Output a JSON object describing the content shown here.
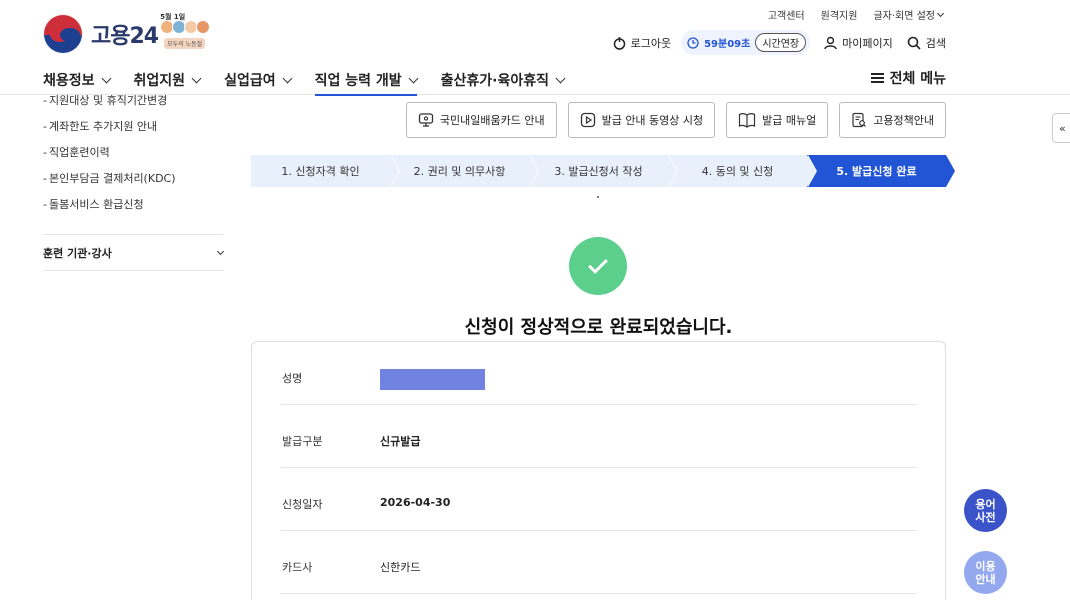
{
  "header": {
    "logo_text": "고용24",
    "logo_badge_date": "5월 1일",
    "logo_badge_ribbon": "모두의 노동절",
    "util_links": [
      "고객센터",
      "원격지원"
    ],
    "util_settings": "글자·회면 설정",
    "logout_label": "로그아웃",
    "session_time": "59분09초",
    "extend_label": "시간연장",
    "mypage_label": "마이페이지",
    "search_label": "검색",
    "all_menu_label": "전체 메뉴"
  },
  "gnb": {
    "items": [
      {
        "label": "채용정보"
      },
      {
        "label": "취업지원"
      },
      {
        "label": "실업급여"
      },
      {
        "label": "직업 능력 개발"
      },
      {
        "label": "출산휴가·육아휴직"
      }
    ],
    "active_index": 3
  },
  "sidebar": {
    "subitems": [
      "지원대상 및 휴직기간변경",
      "계좌한도 추가지원 안내",
      "직업훈련이력",
      "본인부담금 결제처리(KDC)",
      "돌봄서비스 환급신청"
    ],
    "group_label": "훈련 기관·강사",
    "collapse_label": "«"
  },
  "actions": [
    {
      "label": "국민내일배움카드 안내",
      "icon": "card-info-icon"
    },
    {
      "label": "발급 안내 동영상 시청",
      "icon": "play-icon"
    },
    {
      "label": "발급 매뉴얼",
      "icon": "book-icon"
    },
    {
      "label": "고용정책안내",
      "icon": "document-search-icon"
    }
  ],
  "stepper": {
    "steps": [
      "1. 신청자격 확인",
      "2. 권리 및 의무사항",
      "3. 발급신청서 작성",
      "4. 동의 및 신청",
      "5. 발급신청 완료"
    ],
    "active_index": 4
  },
  "result": {
    "message": "신청이 정상적으로 완료되었습니다.",
    "rows": [
      {
        "label": "성명",
        "value": ""
      },
      {
        "label": "발급구분",
        "value": "신규발급"
      },
      {
        "label": "신청일자",
        "value": "2026-04-30"
      },
      {
        "label": "카드사",
        "value": "신한카드"
      }
    ]
  },
  "floating": {
    "dictionary_label": "용어\n사전",
    "guide_label": "이용\n안내"
  },
  "colors": {
    "accent": "#2155d6",
    "success": "#5ccf8c",
    "step_inactive": "#e8f0fb",
    "name_mask": "#7083e0"
  }
}
